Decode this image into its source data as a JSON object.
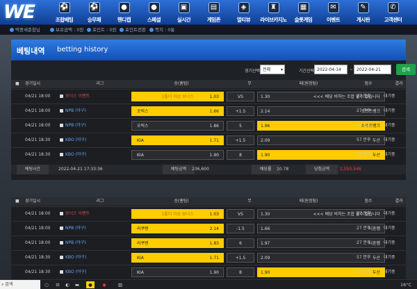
{
  "logo": "WE",
  "nav": [
    {
      "label": "조합베팅",
      "icon": "soccer-ball-icon",
      "g": "⚽"
    },
    {
      "label": "승무패",
      "icon": "soccer-ball-icon",
      "g": "⚽"
    },
    {
      "label": "핸디캡",
      "icon": "basketball-icon",
      "g": "●"
    },
    {
      "label": "스페셜",
      "icon": "basketball-icon",
      "g": "●"
    },
    {
      "label": "실시간",
      "icon": "monitor-icon",
      "g": "▣"
    },
    {
      "label": "게임존",
      "icon": "gamepad-icon",
      "g": "▤"
    },
    {
      "label": "멀티뷰",
      "icon": "network-icon",
      "g": "◈"
    },
    {
      "label": "라이브카지노",
      "icon": "castle-icon",
      "g": "♜"
    },
    {
      "label": "슬롯게임",
      "icon": "slot-icon",
      "g": "▦"
    },
    {
      "label": "이벤트",
      "icon": "gift-icon",
      "g": "✉"
    },
    {
      "label": "게시판",
      "icon": "pen-icon",
      "g": "✎"
    },
    {
      "label": "고객센터",
      "icon": "chat-icon",
      "g": "✆"
    }
  ],
  "userbar": {
    "nick": "먹중세준참님",
    "money": "보유금액 : 0원",
    "point": "포인트 : 0원",
    "convert": "포인트전환",
    "messages": "쪽지 : 0통"
  },
  "board": {
    "title": "베팅내역",
    "subtitle": "betting history"
  },
  "filter": {
    "game_label": "경기선택",
    "game_value": "전체",
    "period_label": "기간선택",
    "date_from": "2022-04-14",
    "tilde": "~",
    "date_to": "2022-04-21",
    "search": "검색"
  },
  "headers": {
    "time": "경기일시",
    "league": "리그",
    "home": "승(홈팀)",
    "draw": "무",
    "away": "패(원정팀)",
    "score": "점수",
    "result": "결과"
  },
  "bet1": {
    "rows": [
      {
        "date": "04/21 18:00",
        "league": "보너스 이벤트",
        "red": true,
        "home": "1폴더 이상 보너스",
        "hodds": "1.03",
        "hsel": true,
        "mid": "VS",
        "away": "<<< 배당 비하는 조합 할수 없습니다",
        "aodds": "1.30",
        "asel": false,
        "score": "27 분후",
        "result": "대기중"
      },
      {
        "date": "04/21 18:00",
        "league": "NPB (야구)",
        "red": false,
        "home": "오릭스",
        "hodds": "1.66",
        "hsel": true,
        "mid": "+1.5",
        "away": "소프트뱅크",
        "aodds": "2.14",
        "asel": false,
        "score": "27 분후",
        "result": "대기중"
      },
      {
        "date": "04/21 18:00",
        "league": "NPB (야구)",
        "red": false,
        "home": "오릭스",
        "hodds": "1.86",
        "hsel": false,
        "mid": "5",
        "away": "소프트뱅크",
        "aodds": "1.96",
        "asel": true,
        "score": "27 분후",
        "result": "대기중"
      },
      {
        "date": "04/21 18:30",
        "league": "KBO (야구)",
        "red": false,
        "home": "KIA",
        "hodds": "1.71",
        "hsel": true,
        "mid": "+1.5",
        "away": "두산",
        "aodds": "2.09",
        "asel": false,
        "score": "57 분후",
        "result": "대기중"
      },
      {
        "date": "04/21 18:30",
        "league": "KBO (야구)",
        "red": false,
        "home": "KIA",
        "hodds": "1.90",
        "hsel": false,
        "mid": "8",
        "away": "두산",
        "aodds": "1.90",
        "asel": true,
        "score": "57 분후",
        "result": "대기중"
      }
    ],
    "summary": {
      "time_label": "베팅시간",
      "time": "2022-04-21 17:33:36",
      "amount_label": "베팅금액",
      "amount": "236,600",
      "rate_label": "배당률",
      "rate": "10.78",
      "win_label": "당첨금액",
      "win": "2,550,546"
    }
  },
  "bet2": {
    "rows": [
      {
        "date": "04/21 18:00",
        "league": "보너스 이벤트",
        "red": true,
        "home": "1폴더 이상 보너스",
        "hodds": "1.03",
        "hsel": true,
        "mid": "VS",
        "away": "<<< 배당 비하는 조합 할수 없습니다",
        "aodds": "1.30",
        "asel": false,
        "score": "27 분후",
        "result": "대기중"
      },
      {
        "date": "04/21 18:00",
        "league": "NPB (야구)",
        "red": false,
        "home": "라쿠텐",
        "hodds": "2.14",
        "hsel": true,
        "mid": "-1.5",
        "away": "니혼햄",
        "aodds": "1.66",
        "asel": false,
        "score": "27 분후",
        "result": "대기중"
      },
      {
        "date": "04/21 18:00",
        "league": "NPB (야구)",
        "red": false,
        "home": "라쿠텐",
        "hodds": "1.83",
        "hsel": true,
        "mid": "6",
        "away": "니혼햄",
        "aodds": "1.97",
        "asel": false,
        "score": "27 분후",
        "result": "대기중"
      },
      {
        "date": "04/21 18:30",
        "league": "KBO (야구)",
        "red": false,
        "home": "KIA",
        "hodds": "1.71",
        "hsel": true,
        "mid": "+1.5",
        "away": "두산",
        "aodds": "2.09",
        "asel": false,
        "score": "57 분후",
        "result": "대기중"
      },
      {
        "date": "04/21 18:30",
        "league": "KBO (야구)",
        "red": false,
        "home": "KIA",
        "hodds": "1.90",
        "hsel": false,
        "mid": "8",
        "away": "두산",
        "aodds": "1.90",
        "asel": true,
        "score": "57 분후",
        "result": "대기중"
      }
    ]
  },
  "taskbar": {
    "search": "검색",
    "temp": "16°C"
  }
}
